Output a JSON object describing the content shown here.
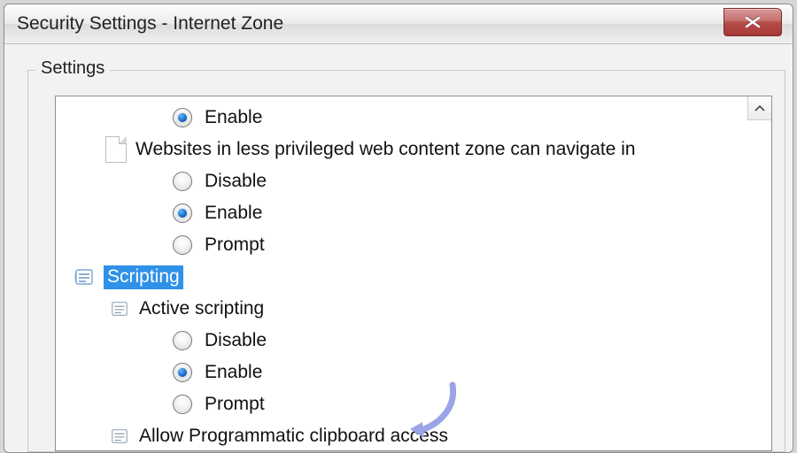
{
  "window": {
    "title": "Security Settings - Internet Zone"
  },
  "group": {
    "label": "Settings"
  },
  "rows": {
    "r0": {
      "label": "Enable"
    },
    "r1": {
      "label": "Websites in less privileged web content zone can navigate in"
    },
    "r2": {
      "label": "Disable"
    },
    "r3": {
      "label": "Enable"
    },
    "r4": {
      "label": "Prompt"
    },
    "r5": {
      "label": "Scripting"
    },
    "r6": {
      "label": "Active scripting"
    },
    "r7": {
      "label": "Disable"
    },
    "r8": {
      "label": "Enable"
    },
    "r9": {
      "label": "Prompt"
    },
    "r10": {
      "label": "Allow Programmatic clipboard access"
    }
  }
}
